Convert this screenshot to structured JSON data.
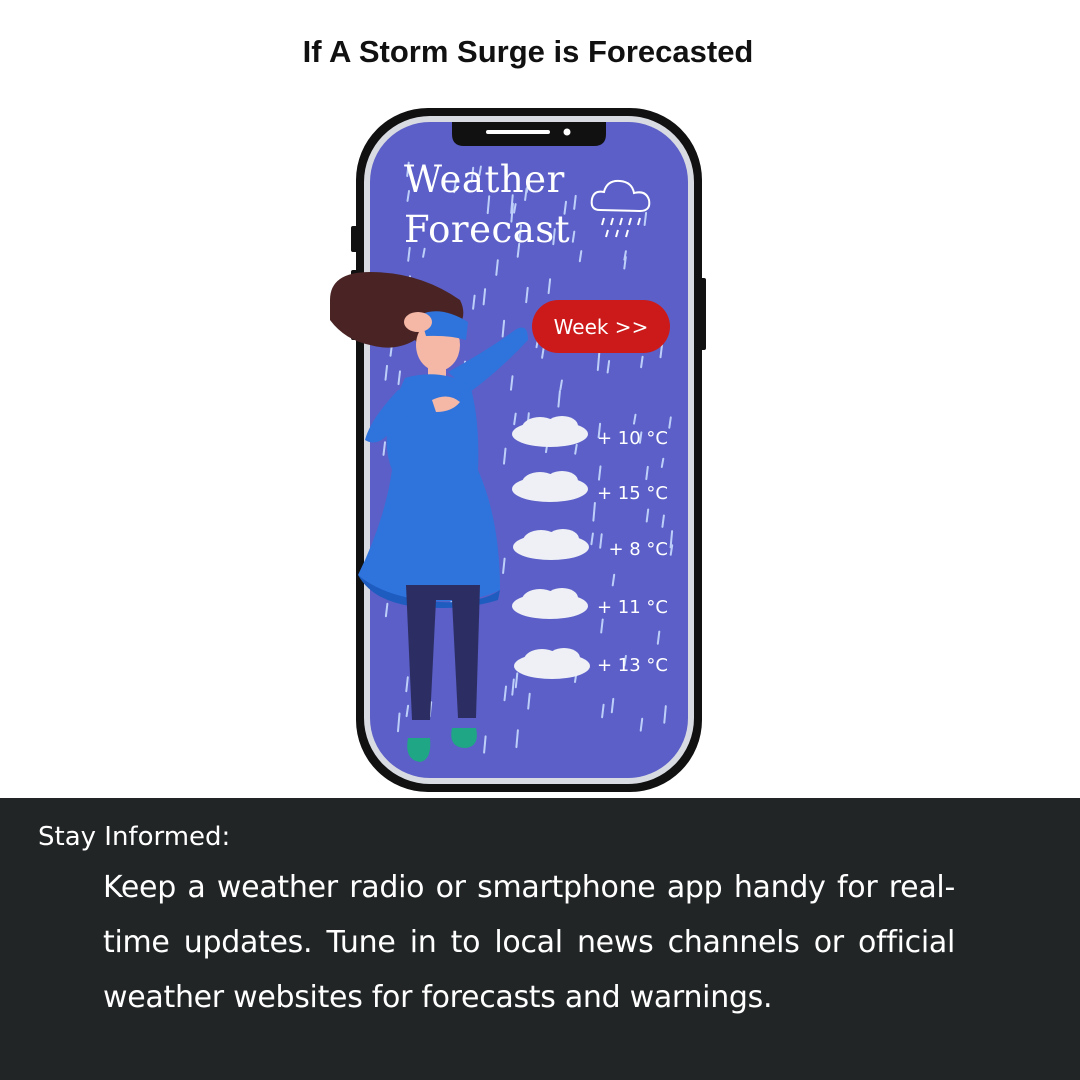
{
  "page": {
    "title": "If A Storm Surge is Forecasted"
  },
  "phone": {
    "app_title_line1": "Weather",
    "app_title_line2": "Forecast",
    "weather_icon": "rain-cloud-icon",
    "week_button_label": "Week >>",
    "forecast": [
      {
        "icon": "cloud-icon",
        "temperature": "+ 10 °C"
      },
      {
        "icon": "cloud-icon",
        "temperature": "+ 15 °C"
      },
      {
        "icon": "cloud-icon",
        "temperature": "+ 8 °C"
      },
      {
        "icon": "cloud-icon",
        "temperature": "+ 11 °C"
      },
      {
        "icon": "cloud-icon",
        "temperature": "+ 13 °C"
      }
    ]
  },
  "info": {
    "heading": "Stay Informed:",
    "body": "Keep a weather radio or smartphone app handy for real-time updates. Tune in to local news channels or official weather websites for forecasts and warnings."
  },
  "colors": {
    "screen": "#5b5fc7",
    "week_button": "#cc1a1a",
    "bottom_panel": "#222526",
    "dress": "#2f74dd"
  }
}
